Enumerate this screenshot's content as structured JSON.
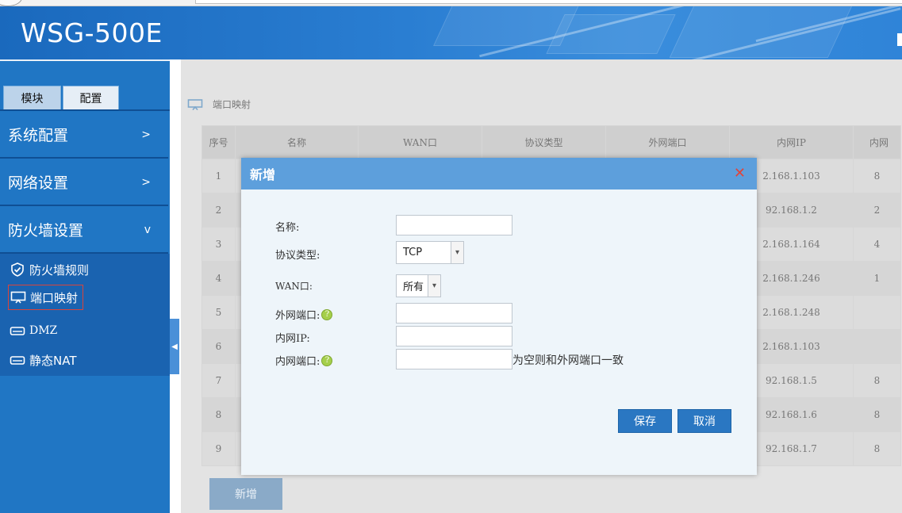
{
  "header": {
    "title": "WSG-500E"
  },
  "sidebar": {
    "tabs": [
      {
        "label": "模块"
      },
      {
        "label": "配置"
      }
    ],
    "menus": [
      {
        "label": "系统配置",
        "chevron": ">"
      },
      {
        "label": "网络设置",
        "chevron": ">"
      },
      {
        "label": "防火墙设置",
        "chevron": "v"
      }
    ],
    "submenus": [
      {
        "label": "防火墙规则",
        "icon": "shield-icon"
      },
      {
        "label": "端口映射",
        "icon": "monitor-icon",
        "active": true
      },
      {
        "label": "DMZ",
        "icon": "router-icon"
      },
      {
        "label": "静态NAT",
        "icon": "router-icon"
      }
    ]
  },
  "main": {
    "breadcrumb": "端口映射",
    "table": {
      "headers": [
        "序号",
        "名称",
        "WAN口",
        "协议类型",
        "外网端口",
        "内网IP",
        "内网"
      ],
      "rows": [
        {
          "index": "1",
          "ip": "2.168.1.103",
          "tail": "8"
        },
        {
          "index": "2",
          "ip": "92.168.1.2",
          "tail": "2"
        },
        {
          "index": "3",
          "ip": "2.168.1.164",
          "tail": "4"
        },
        {
          "index": "4",
          "ip": "2.168.1.246",
          "tail": "1"
        },
        {
          "index": "5",
          "ip": "2.168.1.248",
          "tail": ""
        },
        {
          "index": "6",
          "ip": "2.168.1.103",
          "tail": ""
        },
        {
          "index": "7",
          "ip": "92.168.1.5",
          "tail": "8"
        },
        {
          "index": "8",
          "ip": "92.168.1.6",
          "tail": "8"
        },
        {
          "index": "9",
          "ip": "92.168.1.7",
          "tail": "8"
        }
      ]
    },
    "add_button": "新增"
  },
  "modal": {
    "title": "新增",
    "close": "✕",
    "fields": {
      "name_label": "名称:",
      "protocol_label": "协议类型:",
      "protocol_value": "TCP",
      "wan_label": "WAN口:",
      "wan_value": "所有",
      "ext_port_label": "外网端口:",
      "int_ip_label": "内网IP:",
      "int_port_label": "内网端口:",
      "int_port_hint": "为空则和外网端口一致",
      "help": "?"
    },
    "save": "保存",
    "cancel": "取消"
  },
  "colors": {
    "header": "#2a7ed2",
    "sidebar": "#2076c4",
    "modal_head": "#5d9fdc",
    "button": "#2a77c2",
    "close": "#e0443a"
  }
}
